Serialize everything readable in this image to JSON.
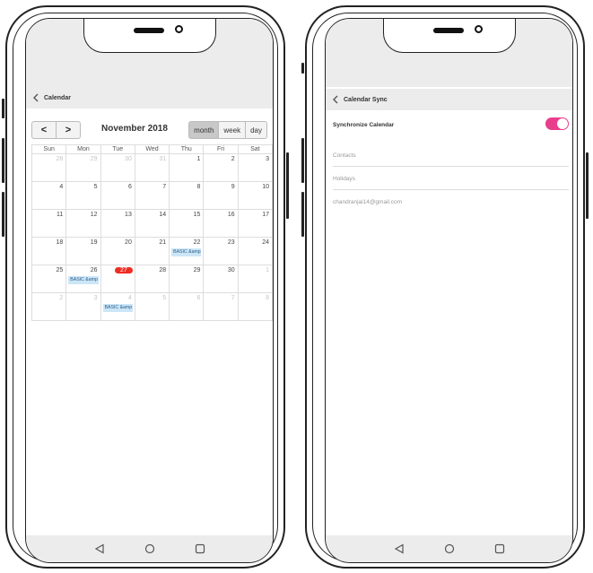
{
  "left_phone": {
    "header_title": "Calendar",
    "toolbar": {
      "prev_label": "<",
      "next_label": ">",
      "month_title": "November 2018",
      "views": [
        "month",
        "week",
        "day"
      ],
      "active_view": "month"
    },
    "weekdays": [
      "Sun",
      "Mon",
      "Tue",
      "Wed",
      "Thu",
      "Fri",
      "Sat"
    ],
    "weeks": [
      [
        {
          "d": "28",
          "o": true
        },
        {
          "d": "29",
          "o": true
        },
        {
          "d": "30",
          "o": true
        },
        {
          "d": "31",
          "o": true
        },
        {
          "d": "1"
        },
        {
          "d": "2"
        },
        {
          "d": "3"
        }
      ],
      [
        {
          "d": "4"
        },
        {
          "d": "5"
        },
        {
          "d": "6"
        },
        {
          "d": "7"
        },
        {
          "d": "8"
        },
        {
          "d": "9"
        },
        {
          "d": "10"
        }
      ],
      [
        {
          "d": "11"
        },
        {
          "d": "12"
        },
        {
          "d": "13"
        },
        {
          "d": "14"
        },
        {
          "d": "15"
        },
        {
          "d": "16"
        },
        {
          "d": "17"
        }
      ],
      [
        {
          "d": "18"
        },
        {
          "d": "19"
        },
        {
          "d": "20"
        },
        {
          "d": "21"
        },
        {
          "d": "22",
          "e": "BASIC &amp"
        },
        {
          "d": "23"
        },
        {
          "d": "24"
        }
      ],
      [
        {
          "d": "25"
        },
        {
          "d": "26",
          "e": "BASIC &amp"
        },
        {
          "d": "27",
          "today": true
        },
        {
          "d": "28"
        },
        {
          "d": "29"
        },
        {
          "d": "30"
        },
        {
          "d": "1",
          "o": true
        }
      ],
      [
        {
          "d": "2",
          "o": true
        },
        {
          "d": "3",
          "o": true
        },
        {
          "d": "4",
          "o": true,
          "e": "BASIC &amp"
        },
        {
          "d": "5",
          "o": true
        },
        {
          "d": "6",
          "o": true
        },
        {
          "d": "7",
          "o": true
        },
        {
          "d": "8",
          "o": true
        }
      ]
    ]
  },
  "right_phone": {
    "header_title": "Calendar Sync",
    "sync_label": "Synchronize Calendar",
    "sync_enabled": true,
    "items": [
      "Contacts",
      "Holidays",
      "chandranjai14@gmail.com"
    ]
  },
  "colors": {
    "accent_pink": "#e83e8c",
    "today_red": "#ee2d24",
    "event_blue": "#cce6f7",
    "bar_gray": "#ececec"
  },
  "icons": {
    "back": "chevron-left-icon",
    "nav": [
      "triangle-back-icon",
      "circle-home-icon",
      "square-recents-icon"
    ]
  }
}
